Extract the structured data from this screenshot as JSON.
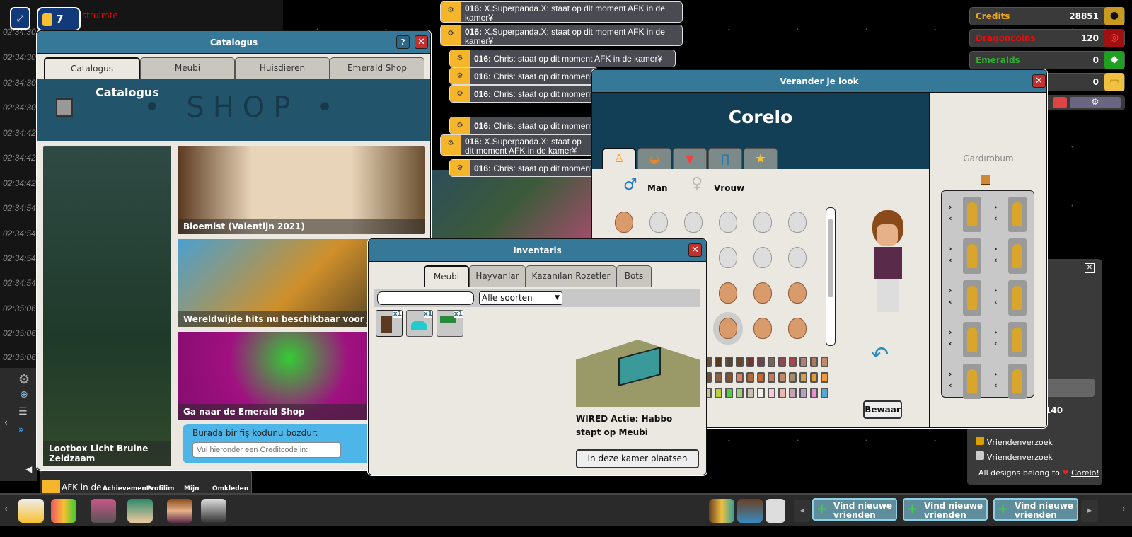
{
  "hud": {
    "badge_count": "7",
    "red_text": "struimte"
  },
  "chatlog": {
    "timestamps": [
      "02:34:30",
      "02:34:30",
      "02:34:30",
      "02:34:30",
      "02:34:42",
      "02:34:42",
      "02:34:42",
      "02:34:54",
      "02:34:54",
      "02:34:54",
      "02:34:54",
      "02:35:06",
      "02:35:06",
      "02:35:06"
    ]
  },
  "bubbles": [
    {
      "user": "016:",
      "text": "X.Superpanda.X: staat op dit moment AFK in de kamer¥"
    },
    {
      "user": "016:",
      "text": "X.Superpanda.X: staat op dit moment AFK in de kamer¥"
    },
    {
      "user": "016:",
      "text": "Chris: staat op dit moment AFK in de kamer¥"
    },
    {
      "user": "016:",
      "text": "Chris: staat op dit moment"
    },
    {
      "user": "016:",
      "text": "Chris: staat op dit moment"
    },
    {
      "user": "016:",
      "text": "Chris: staat op dit moment"
    },
    {
      "user": "016:",
      "text": "X.Superpanda.X: staat op dit moment AFK in de kamer¥"
    },
    {
      "user": "016:",
      "text": "Chris: staat op dit moment"
    }
  ],
  "catalog": {
    "title": "Catalogus",
    "help": "?",
    "tabs": [
      "Catalogus",
      "Meubi",
      "Huisdieren",
      "Emerald Shop"
    ],
    "banner_title": "Catalogus",
    "banner_text": "• SHOP •",
    "tiles": [
      "Lootbox Licht Bruine Zeldzaam",
      "Bloemist (Valentijn 2021)",
      "Wereldwijde hits nu beschikbaar voor Juk",
      "Ga naar de Emerald Shop"
    ],
    "voucher_label": "Burada bir fiş kodunu bozdur:",
    "voucher_placeholder": "Vul hieronder een Creditcode in:"
  },
  "inventory": {
    "title": "Inventaris",
    "tabs": [
      "Meubi",
      "Hayvanlar",
      "Kazanılan Rozetler",
      "Bots"
    ],
    "search_value": "",
    "filter": "Alle soorten",
    "items": [
      {
        "icon": "wired-icon",
        "count": "x1"
      },
      {
        "icon": "cyan-pile-icon",
        "count": "x1"
      },
      {
        "icon": "cash-icon",
        "count": "x1"
      }
    ],
    "selected_name": "WIRED Actie: Habbo stapt op Meubi",
    "place_button": "In deze kamer plaatsen"
  },
  "look": {
    "title": "Verander je look",
    "username": "Corelo",
    "tabs": [
      "body-icon",
      "hat-icon",
      "shirt-icon",
      "pants-icon",
      "star-icon"
    ],
    "male": "Man",
    "female": "Vrouw",
    "save": "Bewaar",
    "wardrobe_title": "Gardırobum",
    "colors": [
      [
        "#7a4a2a",
        "#5a3820",
        "#5a4434",
        "#6a4226",
        "#6a3a30",
        "#6a4450",
        "#7a6458",
        "#8a4a50",
        "#a04a50",
        "#b08070",
        "#b0785a",
        "#c08a6a"
      ],
      [
        "#7a4a2a",
        "#8a6048",
        "#8a5028",
        "#d8806a",
        "#b06a40",
        "#c06a38",
        "#c07c5a",
        "#c08a6a",
        "#a08a6a",
        "#d0a050",
        "#e09a3a",
        "#f09a40"
      ],
      [
        "#d0c090",
        "#b8d040",
        "#50d040",
        "#a0d080",
        "#c8c0b0",
        "#f4f0e8",
        "#f8c8d8",
        "#e8b8b0",
        "#c8a0b0",
        "#b8a0c0",
        "#e890c8",
        "#58a8d0"
      ]
    ]
  },
  "currency": [
    {
      "name": "Credits",
      "value": "28851",
      "color": "#e8a820"
    },
    {
      "name": "Dragoncoins",
      "value": "120",
      "color": "#e01010"
    },
    {
      "name": "Emeralds",
      "value": "0",
      "color": "#30b030"
    },
    {
      "name": "",
      "value": "0",
      "color": "#f0c040"
    }
  ],
  "side_panel": {
    "value": "140",
    "links": [
      "Vriendenverzoek",
      "Vriendenverzoek"
    ],
    "credit_prefix": "All designs belong to",
    "credit_name": "Corelo!"
  },
  "room_menu": [
    "Achievements",
    "Profilim",
    "Mijn",
    "Omkleden"
  ],
  "afk_text": "AFK in de",
  "friends": {
    "buttons": [
      "Vind nieuwe vrienden",
      "Vind nieuwe vrienden",
      "Vind nieuwe vrienden"
    ]
  }
}
